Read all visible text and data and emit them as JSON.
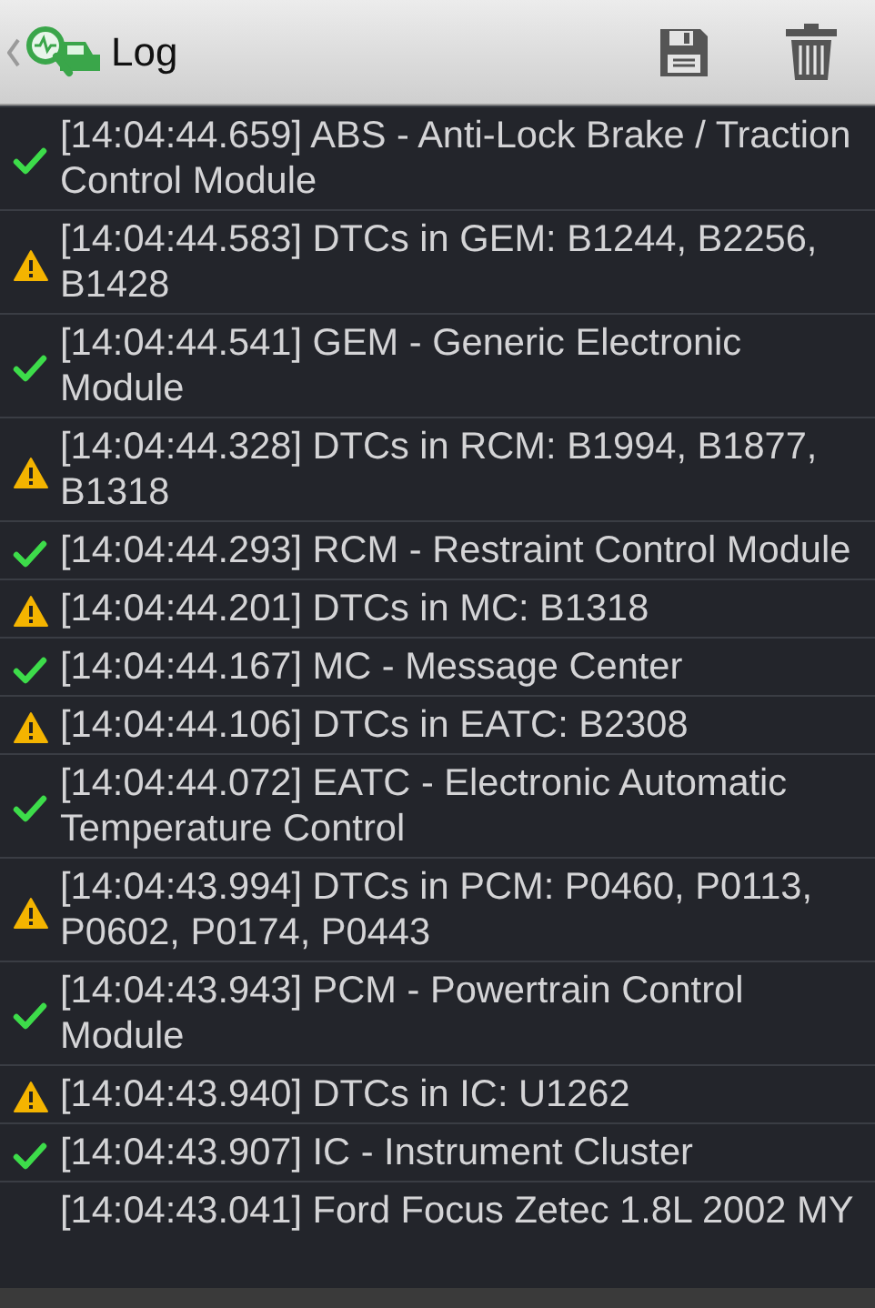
{
  "header": {
    "title": "Log"
  },
  "entries": [
    {
      "kind": "ok",
      "text": "[14:04:44.659] ABS - Anti-Lock Brake / Traction Control Module"
    },
    {
      "kind": "warning",
      "text": "[14:04:44.583] DTCs in GEM: B1244, B2256, B1428"
    },
    {
      "kind": "ok",
      "text": "[14:04:44.541] GEM - Generic Electronic Module"
    },
    {
      "kind": "warning",
      "text": "[14:04:44.328] DTCs in RCM: B1994, B1877, B1318"
    },
    {
      "kind": "ok",
      "text": "[14:04:44.293] RCM - Restraint Control Module"
    },
    {
      "kind": "warning",
      "text": "[14:04:44.201] DTCs in MC: B1318"
    },
    {
      "kind": "ok",
      "text": "[14:04:44.167] MC - Message Center"
    },
    {
      "kind": "warning",
      "text": "[14:04:44.106] DTCs in EATC: B2308"
    },
    {
      "kind": "ok",
      "text": "[14:04:44.072] EATC - Electronic Automatic Temperature Control"
    },
    {
      "kind": "warning",
      "text": "[14:04:43.994] DTCs in PCM: P0460, P0113, P0602, P0174, P0443"
    },
    {
      "kind": "ok",
      "text": "[14:04:43.943] PCM - Powertrain Control Module"
    },
    {
      "kind": "warning",
      "text": "[14:04:43.940] DTCs in IC: U1262"
    },
    {
      "kind": "ok",
      "text": "[14:04:43.907] IC - Instrument Cluster"
    },
    {
      "kind": "info",
      "text": "[14:04:43.041] Ford Focus Zetec 1.8L 2002 MY"
    }
  ]
}
